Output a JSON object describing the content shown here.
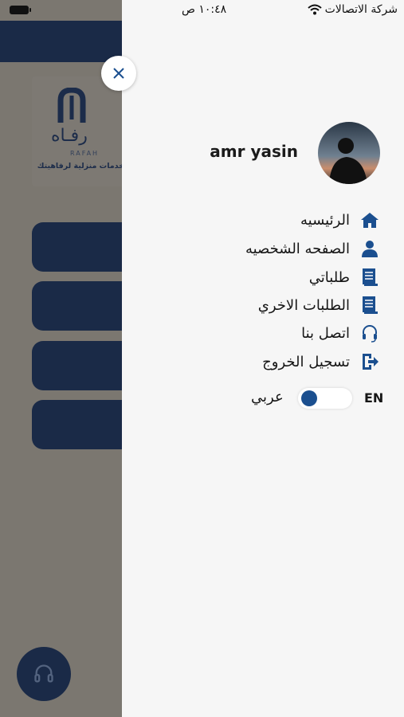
{
  "status_bar": {
    "carrier": "شركة الاتصالات",
    "time": "١٠:٤٨ ص"
  },
  "background_app": {
    "logo_name": "رفـاه",
    "logo_latin": "RAFAH",
    "tagline": "خدمات منزلية لرفاهيتك"
  },
  "drawer": {
    "user_name": "amr yasin",
    "menu": [
      {
        "label": "الرئيسيه",
        "icon": "home-icon"
      },
      {
        "label": "الصفحه الشخصيه",
        "icon": "person-icon"
      },
      {
        "label": "طلباتي",
        "icon": "list-icon"
      },
      {
        "label": "الطلبات الاخري",
        "icon": "list-icon"
      },
      {
        "label": "اتصل بنا",
        "icon": "headset-icon"
      },
      {
        "label": "تسجيل الخروج",
        "icon": "logout-icon"
      }
    ],
    "language": {
      "arabic_label": "عربي",
      "english_label": "EN"
    }
  },
  "colors": {
    "brand_navy": "#1a2a47",
    "icon_blue": "#1b4f8f",
    "drawer_bg": "#f6f6f6",
    "overlay": "#7b7770"
  }
}
